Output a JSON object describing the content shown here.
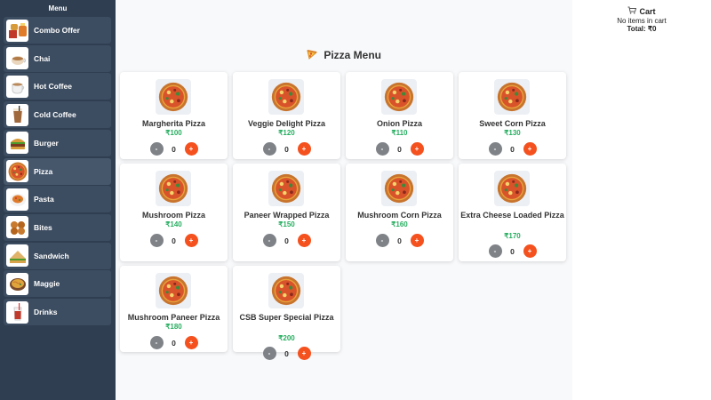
{
  "sidebar": {
    "title": "Menu",
    "items": [
      {
        "label": "Combo Offer",
        "icon": "combo-icon"
      },
      {
        "label": "Chai",
        "icon": "chai-icon"
      },
      {
        "label": "Hot Coffee",
        "icon": "hot-coffee-icon"
      },
      {
        "label": "Cold Coffee",
        "icon": "cold-coffee-icon"
      },
      {
        "label": "Burger",
        "icon": "burger-icon"
      },
      {
        "label": "Pizza",
        "icon": "pizza-icon"
      },
      {
        "label": "Pasta",
        "icon": "pasta-icon"
      },
      {
        "label": "Bites",
        "icon": "bites-icon"
      },
      {
        "label": "Sandwich",
        "icon": "sandwich-icon"
      },
      {
        "label": "Maggie",
        "icon": "maggie-icon"
      },
      {
        "label": "Drinks",
        "icon": "drinks-icon"
      }
    ]
  },
  "main": {
    "title": "Pizza Menu",
    "products": [
      {
        "name": "Margherita Pizza",
        "price": "₹100",
        "qty": "0",
        "minus": "-",
        "plus": "+"
      },
      {
        "name": "Veggie Delight Pizza",
        "price": "₹120",
        "qty": "0",
        "minus": "-",
        "plus": "+"
      },
      {
        "name": "Onion Pizza",
        "price": "₹110",
        "qty": "0",
        "minus": "-",
        "plus": "+"
      },
      {
        "name": "Sweet Corn Pizza",
        "price": "₹130",
        "qty": "0",
        "minus": "-",
        "plus": "+"
      },
      {
        "name": "Mushroom Pizza",
        "price": "₹140",
        "qty": "0",
        "minus": "-",
        "plus": "+"
      },
      {
        "name": "Paneer Wrapped Pizza",
        "price": "₹150",
        "qty": "0",
        "minus": "-",
        "plus": "+"
      },
      {
        "name": "Mushroom Corn Pizza",
        "price": "₹160",
        "qty": "0",
        "minus": "-",
        "plus": "+"
      },
      {
        "name": "Extra Cheese Loaded Pizza",
        "price": "₹170",
        "qty": "0",
        "minus": "-",
        "plus": "+"
      },
      {
        "name": "Mushroom Paneer Pizza",
        "price": "₹180",
        "qty": "0",
        "minus": "-",
        "plus": "+"
      },
      {
        "name": "CSB Super Special Pizza",
        "price": "₹200",
        "qty": "0",
        "minus": "-",
        "plus": "+"
      }
    ]
  },
  "cart": {
    "title": "Cart",
    "empty_text": "No items in cart",
    "total": "Total: ₹0"
  },
  "colors": {
    "sidebar_bg": "#2f3e50",
    "price": "#27ae60",
    "plus_button": "#f4511e",
    "minus_button": "#7f8388"
  }
}
